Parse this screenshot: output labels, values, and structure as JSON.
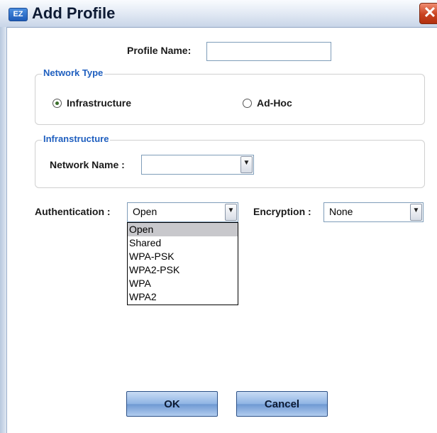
{
  "window": {
    "title": "Add Profile",
    "app_icon_text": "EZ",
    "close_glyph": "✕"
  },
  "profile": {
    "label": "Profile Name:",
    "value": ""
  },
  "network_type": {
    "legend": "Network Type",
    "options": [
      {
        "label": "Infrastructure",
        "selected": true
      },
      {
        "label": "Ad-Hoc",
        "selected": false
      }
    ]
  },
  "infrastructure": {
    "legend": "Infranstructure",
    "network_name_label": "Network Name :",
    "network_name_value": ""
  },
  "authentication": {
    "label": "Authentication :",
    "value": "Open",
    "options": [
      "Open",
      "Shared",
      "WPA-PSK",
      "WPA2-PSK",
      "WPA",
      "WPA2"
    ],
    "highlighted": "Open"
  },
  "encryption": {
    "label": "Encryption :",
    "value": "None"
  },
  "buttons": {
    "ok": "OK",
    "cancel": "Cancel"
  },
  "icons": {
    "dropdown": "chevron-down-icon",
    "close": "close-icon",
    "app": "ez-app-icon"
  },
  "colors": {
    "legend": "#1f5fbf",
    "button": "#8fb4e4",
    "close": "#c9421f",
    "highlight": "#c8c8cc"
  }
}
